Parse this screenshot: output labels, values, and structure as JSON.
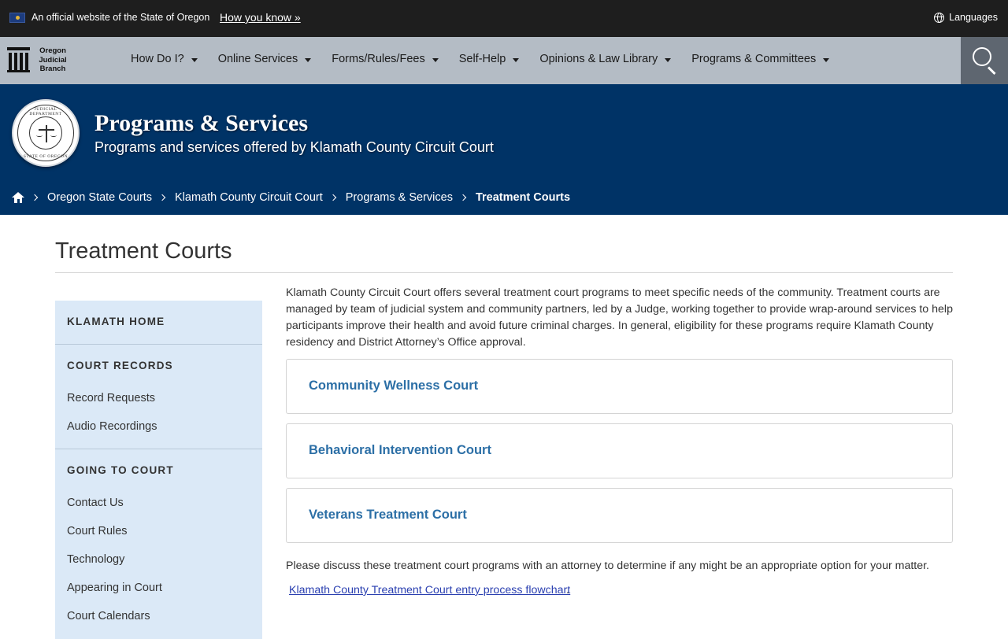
{
  "banner": {
    "official_text": "An official website of the State of Oregon",
    "how_you_know": "How you know »",
    "languages": "Languages"
  },
  "logo": {
    "line1": "Oregon",
    "line2": "Judicial",
    "line3": "Branch"
  },
  "nav": {
    "items": [
      {
        "label": "How Do I?"
      },
      {
        "label": "Online Services"
      },
      {
        "label": "Forms/Rules/Fees"
      },
      {
        "label": "Self-Help"
      },
      {
        "label": "Opinions & Law Library"
      },
      {
        "label": "Programs & Committees"
      }
    ]
  },
  "seal": {
    "top_text": "JUDICIAL DEPARTMENT",
    "bottom_text": "STATE OF OREGON"
  },
  "hero": {
    "title": "Programs & Services",
    "subtitle": "Programs and services offered by Klamath County Circuit Court"
  },
  "breadcrumb": {
    "items": [
      "Oregon State Courts",
      "Klamath County Circuit Court",
      "Programs & Services"
    ],
    "current": "Treatment Courts"
  },
  "page": {
    "title": "Treatment Courts",
    "intro": "Klamath County Circuit Court offers several treatment court programs to meet specific needs of the community. Treatment courts are managed by team of judicial system and community partners, led by a Judge, working together to provide wrap-around services to help participants improve their health and avoid future criminal charges. In general, eligibility for these programs require Klamath County residency and District Attorney’s Office approval.",
    "cards": [
      {
        "title": "Community Wellness Court"
      },
      {
        "title": "Behavioral Intervention Court"
      },
      {
        "title": "Veterans Treatment Court"
      }
    ],
    "outro": "Please discuss these treatment court programs with an attorney to determine if any might be an appropriate option for your matter.",
    "flowchart_link": "Klamath County Treatment Court entry process flowchart",
    "flowchart_punct": "."
  },
  "sidebar": {
    "home": "KLAMATH HOME",
    "court_records": {
      "heading": "COURT RECORDS",
      "links": [
        "Record Requests",
        "Audio Recordings"
      ]
    },
    "going_to_court": {
      "heading": "GOING TO COURT",
      "links": [
        "Contact Us",
        "Court Rules",
        "Technology",
        "Appearing in Court",
        "Court Calendars"
      ]
    }
  },
  "colors": {
    "banner_bg": "#1e1e1e",
    "nav_bg": "#b4bcc5",
    "hero_bg": "#003366",
    "sidebar_bg": "#dbe9f7",
    "card_title": "#2c6fa6",
    "link": "#2a3fb0"
  },
  "icons": [
    "oregon-flag-icon",
    "globe-icon",
    "courthouse-pillars-icon",
    "search-icon",
    "judicial-seal-icon",
    "home-icon",
    "chevron-right-icon",
    "caret-down-icon"
  ]
}
